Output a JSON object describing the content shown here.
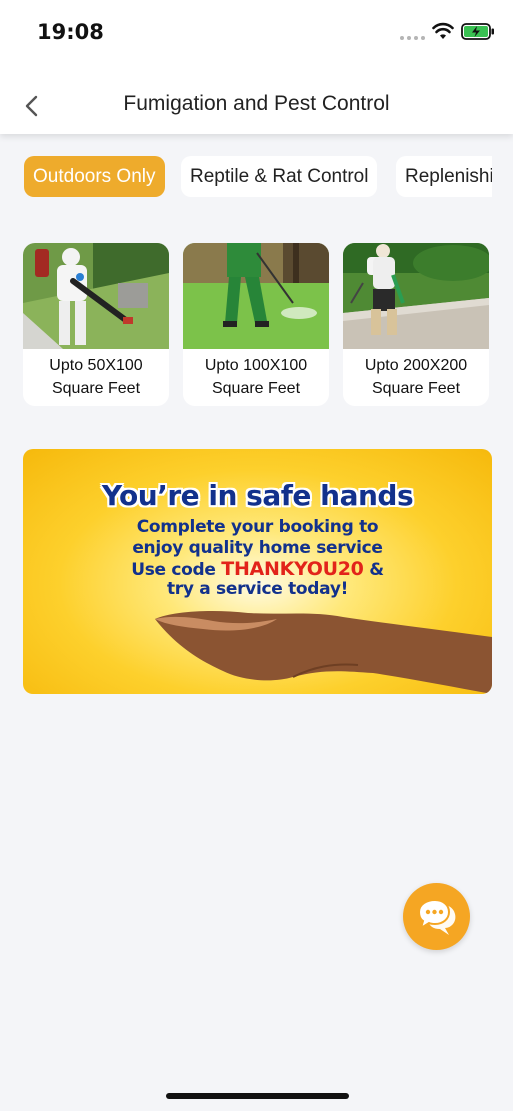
{
  "status_bar": {
    "time": "19:08"
  },
  "nav": {
    "title": "Fumigation and Pest Control"
  },
  "tabs": [
    {
      "label": "Outdoors Only",
      "active": true
    },
    {
      "label": "Reptile & Rat Control",
      "active": false
    },
    {
      "label": "Replenishi",
      "active": false
    }
  ],
  "services": [
    {
      "line1": "Upto 50X100",
      "line2": "Square Feet"
    },
    {
      "line1": "Upto 100X100",
      "line2": "Square Feet"
    },
    {
      "line1": "Upto 200X200",
      "line2": "Square Feet"
    }
  ],
  "banner": {
    "title": "You’re in safe hands",
    "line1": "Complete your booking to",
    "line2": "enjoy quality home service",
    "line3_prefix": "Use code",
    "promo_code": "THANKYOU20",
    "line3_suffix": "&",
    "line4": "try a service today!"
  },
  "colors": {
    "accent": "#eeab2c",
    "chat_button": "#f5a623",
    "banner_text": "#12318c",
    "promo": "#e2231a"
  },
  "icons": {
    "back": "chevron-left-icon",
    "chat": "chat-bubbles-icon",
    "wifi": "wifi-icon",
    "battery": "battery-charging-icon"
  }
}
